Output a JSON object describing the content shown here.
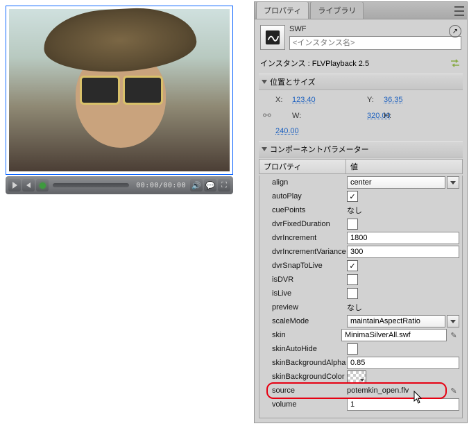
{
  "player": {
    "timecode": "00:00/00:00"
  },
  "panel": {
    "tabs": {
      "properties": "プロパティ",
      "library": "ライブラリ"
    },
    "type_label": "SWF",
    "instance_placeholder": "<インスタンス名>",
    "instance_label": "インスタンス : FLVPlayback 2.5"
  },
  "sections": {
    "pos_size": "位置とサイズ",
    "component_params": "コンポーネントパラメーター"
  },
  "pos": {
    "x_label": "X:",
    "x": "123.40",
    "y_label": "Y:",
    "y": "36.35",
    "w_label": "W:",
    "w": "320.00",
    "h_label": "H:",
    "h": "240.00"
  },
  "param_header": {
    "name": "プロパティ",
    "value": "値"
  },
  "params": {
    "align": {
      "label": "align",
      "value": "center",
      "kind": "combo"
    },
    "autoPlay": {
      "label": "autoPlay",
      "value": true,
      "kind": "check"
    },
    "cuePoints": {
      "label": "cuePoints",
      "value": "なし",
      "kind": "text"
    },
    "dvrFixedDuration": {
      "label": "dvrFixedDuration",
      "value": false,
      "kind": "check"
    },
    "dvrIncrement": {
      "label": "dvrIncrement",
      "value": "1800",
      "kind": "field"
    },
    "dvrIncrementVariance": {
      "label": "dvrIncrementVariance",
      "value": "300",
      "kind": "field"
    },
    "dvrSnapToLive": {
      "label": "dvrSnapToLive",
      "value": true,
      "kind": "check"
    },
    "isDVR": {
      "label": "isDVR",
      "value": false,
      "kind": "check"
    },
    "isLive": {
      "label": "isLive",
      "value": false,
      "kind": "check"
    },
    "preview": {
      "label": "preview",
      "value": "なし",
      "kind": "text"
    },
    "scaleMode": {
      "label": "scaleMode",
      "value": "maintainAspectRatio",
      "kind": "combo"
    },
    "skin": {
      "label": "skin",
      "value": "MinimaSilverAll.swf",
      "kind": "field_pencil"
    },
    "skinAutoHide": {
      "label": "skinAutoHide",
      "value": false,
      "kind": "check"
    },
    "skinBackgroundAlpha": {
      "label": "skinBackgroundAlpha",
      "value": "0.85",
      "kind": "field"
    },
    "skinBackgroundColor": {
      "label": "skinBackgroundColor",
      "value": "",
      "kind": "color"
    },
    "source": {
      "label": "source",
      "value": "potemkin_open.flv",
      "kind": "highlight_pencil"
    },
    "volume": {
      "label": "volume",
      "value": "1",
      "kind": "field"
    }
  }
}
